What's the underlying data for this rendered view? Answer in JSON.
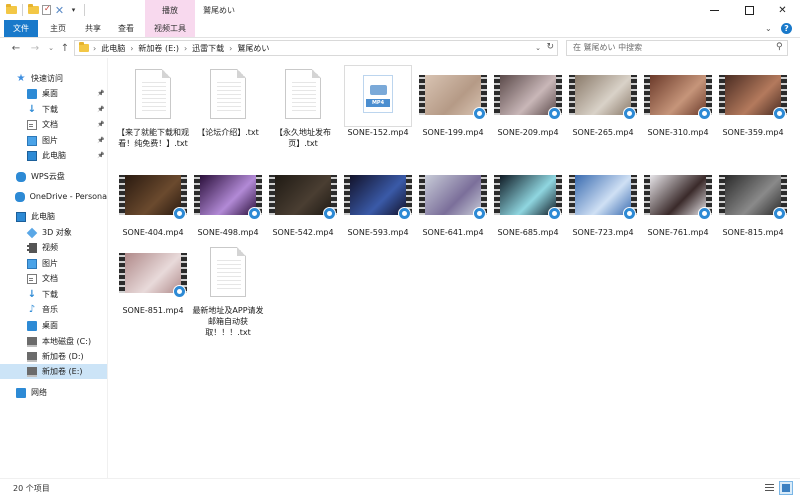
{
  "window": {
    "title": "鷲尾めい",
    "context_tab_header": "播放"
  },
  "ribbon": {
    "tabs": [
      {
        "label": "文件"
      },
      {
        "label": "主页"
      },
      {
        "label": "共享"
      },
      {
        "label": "查看"
      },
      {
        "label": "视频工具"
      }
    ],
    "help": "?"
  },
  "address": {
    "crumbs": [
      "此电脑",
      "新加卷 (E:)",
      "迅雷下载",
      "鷲尾めい"
    ],
    "search_placeholder": "在 鷲尾めい 中搜索"
  },
  "nav": {
    "items": [
      {
        "label": "快速访问",
        "icon": "star-icon"
      },
      {
        "label": "桌面",
        "icon": "desktop-icon",
        "pinned": true
      },
      {
        "label": "下载",
        "icon": "download-icon",
        "pinned": true
      },
      {
        "label": "文档",
        "icon": "document-icon",
        "pinned": true
      },
      {
        "label": "图片",
        "icon": "pictures-icon",
        "pinned": true
      },
      {
        "label": "此电脑",
        "icon": "pc-icon",
        "pinned": true
      },
      {
        "label": "WPS云盘",
        "icon": "cloud-icon"
      },
      {
        "label": "OneDrive - Persona",
        "icon": "onedrive-icon"
      },
      {
        "label": "此电脑",
        "icon": "pc-icon"
      },
      {
        "label": "3D 对象",
        "icon": "3d-objects-icon"
      },
      {
        "label": "视频",
        "icon": "videos-icon"
      },
      {
        "label": "图片",
        "icon": "pictures-icon"
      },
      {
        "label": "文档",
        "icon": "document-icon"
      },
      {
        "label": "下载",
        "icon": "download-icon"
      },
      {
        "label": "音乐",
        "icon": "music-icon"
      },
      {
        "label": "桌面",
        "icon": "desktop-icon"
      },
      {
        "label": "本地磁盘 (C:)",
        "icon": "drive-icon"
      },
      {
        "label": "新加卷 (D:)",
        "icon": "drive-icon"
      },
      {
        "label": "新加卷 (E:)",
        "icon": "drive-icon",
        "selected": true
      },
      {
        "label": "网络",
        "icon": "network-icon"
      }
    ],
    "pin_glyph": "📌"
  },
  "files": [
    {
      "name": "【来了就能下载和观看！纯免费！】.txt",
      "kind": "txt"
    },
    {
      "name": "【论坛介绍】.txt",
      "kind": "txt"
    },
    {
      "name": "【永久地址发布页】.txt",
      "kind": "txt"
    },
    {
      "name": "SONE-152.mp4",
      "kind": "mp4-placeholder",
      "tag": "MP4"
    },
    {
      "name": "SONE-199.mp4",
      "kind": "video",
      "colors": [
        "#d8c3b2",
        "#b59a86"
      ]
    },
    {
      "name": "SONE-209.mp4",
      "kind": "video",
      "colors": [
        "#5b4a4a",
        "#c9b7b8"
      ]
    },
    {
      "name": "SONE-265.mp4",
      "kind": "video",
      "colors": [
        "#8a7a6a",
        "#d9d2c8"
      ]
    },
    {
      "name": "SONE-310.mp4",
      "kind": "video",
      "colors": [
        "#6b3a2a",
        "#c6957a"
      ]
    },
    {
      "name": "SONE-359.mp4",
      "kind": "video",
      "colors": [
        "#4a2c22",
        "#b47a5d"
      ]
    },
    {
      "name": "SONE-404.mp4",
      "kind": "video",
      "colors": [
        "#2a1a10",
        "#6b4a2e"
      ]
    },
    {
      "name": "SONE-498.mp4",
      "kind": "video",
      "colors": [
        "#2a0f3a",
        "#b28ad6"
      ]
    },
    {
      "name": "SONE-542.mp4",
      "kind": "video",
      "colors": [
        "#1f1a14",
        "#4a3e32"
      ]
    },
    {
      "name": "SONE-593.mp4",
      "kind": "video",
      "colors": [
        "#12122a",
        "#3a5aa8"
      ]
    },
    {
      "name": "SONE-641.mp4",
      "kind": "video",
      "colors": [
        "#c8ccd8",
        "#7b6f9a"
      ]
    },
    {
      "name": "SONE-685.mp4",
      "kind": "video",
      "colors": [
        "#0f1a24",
        "#8fd6e0"
      ]
    },
    {
      "name": "SONE-723.mp4",
      "kind": "video",
      "colors": [
        "#3a6bb0",
        "#cfe0f4"
      ]
    },
    {
      "name": "SONE-761.mp4",
      "kind": "video",
      "colors": [
        "#e8e6ea",
        "#3a2a2a"
      ]
    },
    {
      "name": "SONE-815.mp4",
      "kind": "video",
      "colors": [
        "#2a2a2a",
        "#8a8a8a"
      ]
    },
    {
      "name": "SONE-851.mp4",
      "kind": "video",
      "colors": [
        "#b08a8a",
        "#e8dada"
      ]
    },
    {
      "name": "最新地址及APP请发邮箱自动获取！！！.txt",
      "kind": "txt"
    }
  ],
  "status": {
    "item_count": "20 个项目"
  }
}
